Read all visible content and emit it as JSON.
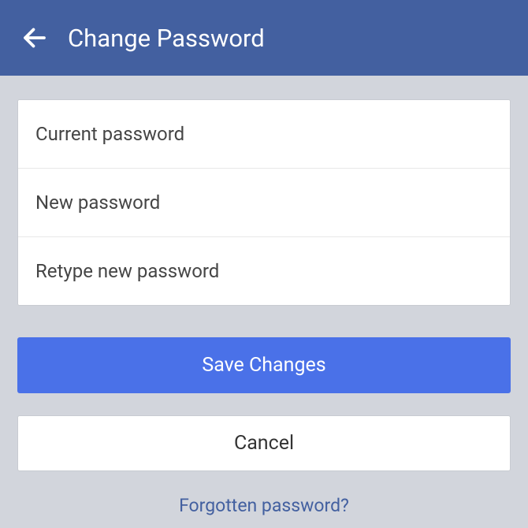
{
  "header": {
    "title": "Change Password"
  },
  "fields": {
    "current_placeholder": "Current password",
    "new_placeholder": "New password",
    "retype_placeholder": "Retype new password"
  },
  "buttons": {
    "save_label": "Save Changes",
    "cancel_label": "Cancel"
  },
  "links": {
    "forgot_label": "Forgotten password?"
  }
}
